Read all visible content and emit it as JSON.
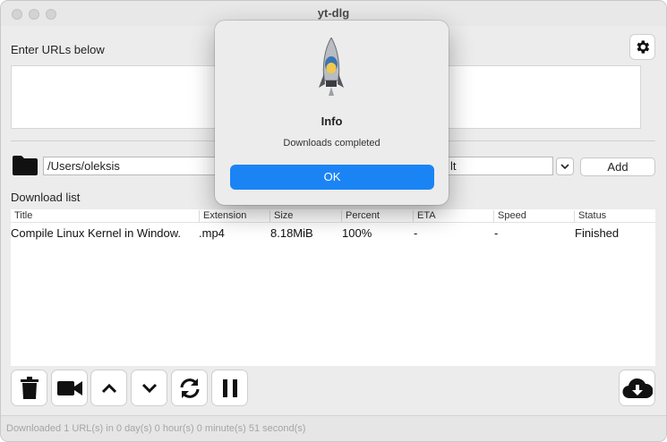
{
  "window": {
    "title": "yt-dlg"
  },
  "urls": {
    "label": "Enter URLs below",
    "value": ""
  },
  "save_path": {
    "value": "/Users/oleksis",
    "format_tail": "lt"
  },
  "add_button": "Add",
  "download_list": {
    "label": "Download list",
    "columns": [
      "Title",
      "Extension",
      "Size",
      "Percent",
      "ETA",
      "Speed",
      "Status"
    ],
    "rows": [
      [
        "Compile Linux Kernel in Window.",
        ".mp4",
        "8.18MiB",
        "100%",
        "-",
        "-",
        "Finished"
      ]
    ]
  },
  "toolbar": {
    "icons": [
      "trash-icon",
      "video-camera-icon",
      "chevron-up-icon",
      "chevron-down-icon",
      "refresh-icon",
      "pause-icon",
      "cloud-download-icon"
    ]
  },
  "statusbar": {
    "text": "Downloaded 1 URL(s) in 0 day(s) 0 hour(s) 0 minute(s) 51 second(s)"
  },
  "dialog": {
    "title": "Info",
    "message": "Downloads completed",
    "ok": "OK",
    "icon": "python-rocket-icon"
  },
  "colors": {
    "accent": "#1b84f5",
    "window_bg": "#ececec"
  }
}
